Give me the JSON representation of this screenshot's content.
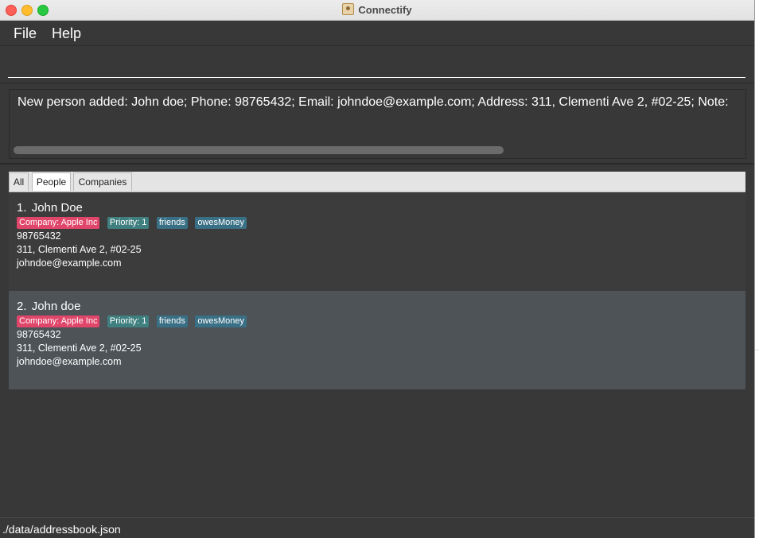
{
  "window": {
    "title": "Connectify"
  },
  "menu": {
    "file": "File",
    "help": "Help"
  },
  "command": {
    "value": ""
  },
  "result": {
    "text": "New person added: John doe; Phone: 98765432; Email: johndoe@example.com; Address: 311, Clementi Ave 2, #02-25; Note:"
  },
  "tabs": [
    {
      "label": "All"
    },
    {
      "label": "People"
    },
    {
      "label": "Companies"
    }
  ],
  "active_tab": "People",
  "colors": {
    "company_tag": "#e0456a",
    "priority_tag": "#3f7f7f",
    "tag": "#3a7085"
  },
  "people": [
    {
      "index": "1.",
      "name": "John Doe",
      "company_tag": "Company: Apple Inc",
      "priority_tag": "Priority: 1",
      "tags": [
        "friends",
        "owesMoney"
      ],
      "phone": "98765432",
      "address": "311, Clementi Ave 2, #02-25",
      "email": "johndoe@example.com"
    },
    {
      "index": "2.",
      "name": "John doe",
      "company_tag": "Company: Apple Inc",
      "priority_tag": "Priority: 1",
      "tags": [
        "friends",
        "owesMoney"
      ],
      "phone": "98765432",
      "address": "311, Clementi Ave 2, #02-25",
      "email": "johndoe@example.com"
    }
  ],
  "status": {
    "path": "./data/addressbook.json"
  }
}
